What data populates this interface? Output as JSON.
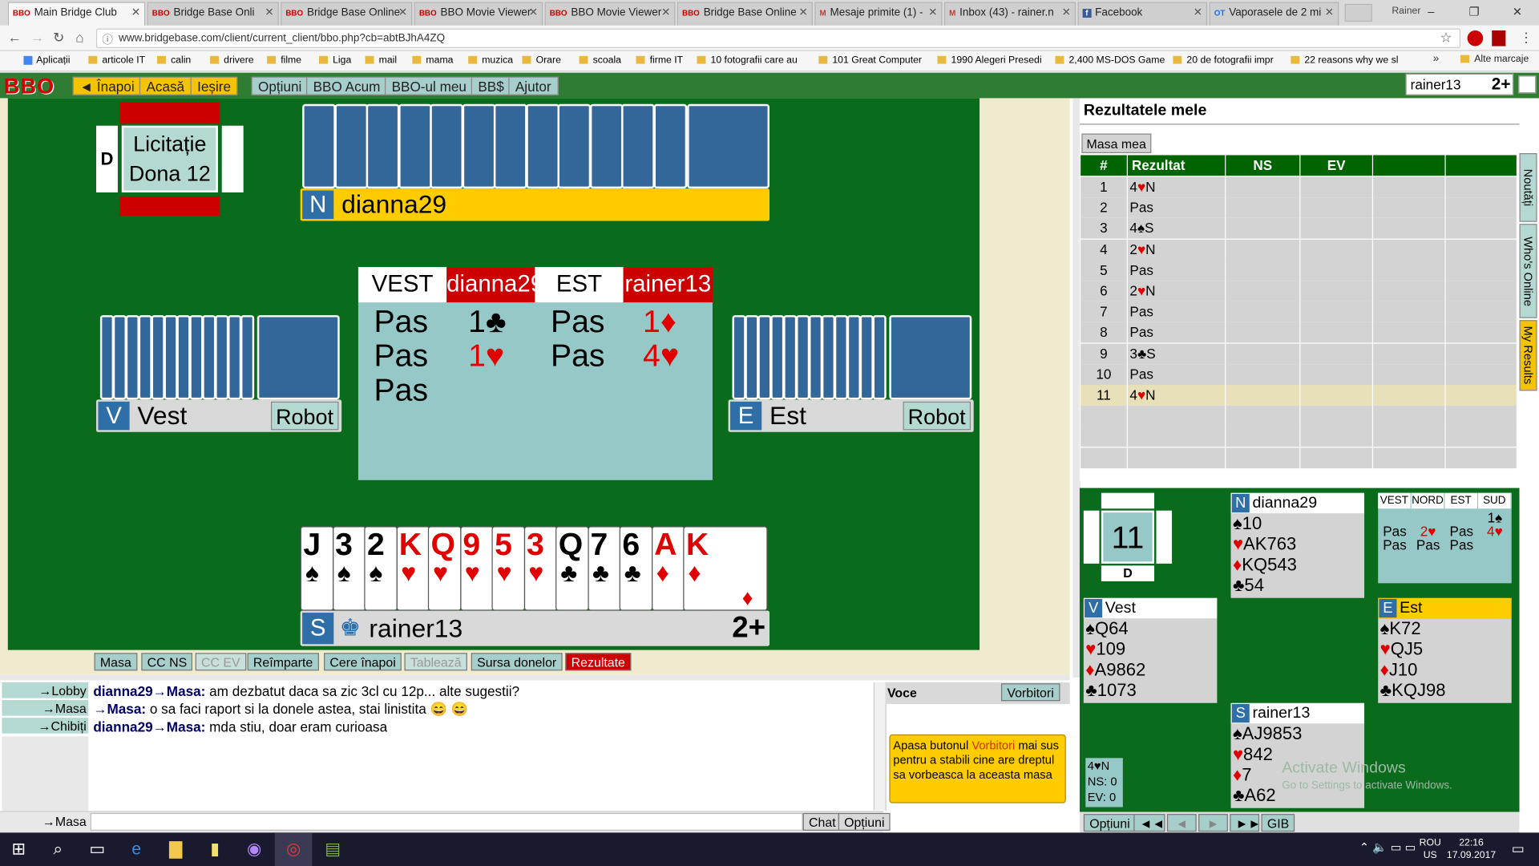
{
  "browser": {
    "tabs": [
      {
        "label": "Main Bridge Club",
        "icon": "BBO"
      },
      {
        "label": "Bridge Base Onli",
        "icon": "BBO"
      },
      {
        "label": "Bridge Base Online",
        "icon": "BBO"
      },
      {
        "label": "BBO Movie Viewer",
        "icon": "BBO"
      },
      {
        "label": "BBO Movie Viewer",
        "icon": "BBO"
      },
      {
        "label": "Bridge Base Online",
        "icon": "BBO"
      },
      {
        "label": "Mesaje primite (1) -",
        "icon": "M"
      },
      {
        "label": "Inbox (43) - rainer.n",
        "icon": "M"
      },
      {
        "label": "Facebook",
        "icon": "f"
      },
      {
        "label": "Vaporasele de 2 mi",
        "icon": "OT"
      }
    ],
    "user_name": "Rainer",
    "url": "www.bridgebase.com/client/current_client/bbo.php?cb=abtBJhA4ZQ",
    "bookmarks": [
      "Aplicații",
      "articole IT",
      "calin",
      "drivere",
      "filme",
      "Liga",
      "mail",
      "mama",
      "muzica",
      "Orare",
      "scoala",
      "firme IT",
      "10 fotografii care au",
      "101 Great Computer",
      "1990 Alegeri Presedi",
      "2,400 MS-DOS Game",
      "20 de fotografii impr",
      "22 reasons why we sl"
    ],
    "bookmarks_more": "»",
    "other_bookmarks": "Alte marcaje"
  },
  "bbo_toolbar": {
    "logo": "BBO",
    "back": "◄ Înapoi",
    "home": "Acasă",
    "exit": "Ieșire",
    "options": "Opțiuni",
    "bbo_now": "BBO Acum",
    "my_bbo": "BBO-ul meu",
    "bbs": "BB$",
    "help": "Ajutor",
    "username": "rainer13",
    "badge": "2+"
  },
  "table": {
    "dealer_label": "D",
    "phase_line1": "Licitație",
    "phase_line2": "Dona 12",
    "north": {
      "seat": "N",
      "name": "dianna29"
    },
    "west": {
      "seat": "V",
      "name": "Vest",
      "tag": "Robot"
    },
    "east": {
      "seat": "E",
      "name": "Est",
      "tag": "Robot"
    },
    "south": {
      "seat": "S",
      "name": "rainer13",
      "badge": "2+"
    },
    "bidding_headers": [
      "VEST",
      "dianna29",
      "EST",
      "rainer13"
    ],
    "bids": [
      {
        "text": "Pas",
        "color": "#000"
      },
      {
        "text": "1♣",
        "color": "#000"
      },
      {
        "text": "Pas",
        "color": "#000"
      },
      {
        "text": "1♦",
        "color": "#e00000"
      },
      {
        "text": "Pas",
        "color": "#000"
      },
      {
        "text": "1♥",
        "color": "#e00000"
      },
      {
        "text": "Pas",
        "color": "#000"
      },
      {
        "text": "4♥",
        "color": "#e00000"
      },
      {
        "text": "Pas",
        "color": "#000"
      }
    ],
    "south_hand": [
      {
        "rank": "J",
        "suit": "♠",
        "red": false
      },
      {
        "rank": "3",
        "suit": "♠",
        "red": false
      },
      {
        "rank": "2",
        "suit": "♠",
        "red": false
      },
      {
        "rank": "K",
        "suit": "♥",
        "red": true
      },
      {
        "rank": "Q",
        "suit": "♥",
        "red": true
      },
      {
        "rank": "9",
        "suit": "♥",
        "red": true
      },
      {
        "rank": "5",
        "suit": "♥",
        "red": true
      },
      {
        "rank": "3",
        "suit": "♥",
        "red": true
      },
      {
        "rank": "Q",
        "suit": "♣",
        "red": false
      },
      {
        "rank": "7",
        "suit": "♣",
        "red": false
      },
      {
        "rank": "6",
        "suit": "♣",
        "red": false
      },
      {
        "rank": "A",
        "suit": "♦",
        "red": true
      },
      {
        "rank": "K",
        "suit": "♦",
        "red": true
      }
    ],
    "bottom_buttons": [
      "Masa",
      "CC NS",
      "CC EV",
      "Reîmparte",
      "Cere înapoi",
      "Tablează",
      "Sursa donelor",
      "Rezultate"
    ]
  },
  "results": {
    "title": "Rezultatele mele",
    "tab": "Masa mea",
    "columns": [
      "#",
      "Rezultat",
      "NS",
      "EV"
    ],
    "rows": [
      {
        "n": "1",
        "r": "4♥N",
        "red": true
      },
      {
        "n": "2",
        "r": "Pas",
        "red": false
      },
      {
        "n": "3",
        "r": "4♠S",
        "red": false
      },
      {
        "n": "4",
        "r": "2♥N",
        "red": true
      },
      {
        "n": "5",
        "r": "Pas",
        "red": false
      },
      {
        "n": "6",
        "r": "2♥N",
        "red": true
      },
      {
        "n": "7",
        "r": "Pas",
        "red": false
      },
      {
        "n": "8",
        "r": "Pas",
        "red": false
      },
      {
        "n": "9",
        "r": "3♣S",
        "red": false
      },
      {
        "n": "10",
        "r": "Pas",
        "red": false
      },
      {
        "n": "11",
        "r": "4♥N",
        "red": true
      }
    ],
    "side_tabs": [
      "Noutăți",
      "Who's Online",
      "My Results"
    ]
  },
  "mini": {
    "board": "11",
    "dealer": "D",
    "north": {
      "seat": "N",
      "name": "dianna29",
      "s": "10",
      "h": "AK763",
      "d": "KQ543",
      "c": "54"
    },
    "west": {
      "seat": "V",
      "name": "Vest",
      "s": "Q64",
      "h": "109",
      "d": "A9862",
      "c": "1073"
    },
    "east": {
      "seat": "E",
      "name": "Est",
      "s": "K72",
      "h": "QJ5",
      "d": "J10",
      "c": "KQJ98"
    },
    "south": {
      "seat": "S",
      "name": "rainer13",
      "s": "AJ9853",
      "h": "842",
      "d": "7",
      "c": "A62"
    },
    "auction_headers": [
      "VEST",
      "NORD",
      "EST",
      "SUD"
    ],
    "auction_row1": [
      "",
      "",
      "",
      "1♠"
    ],
    "auction_row2": [
      "Pas",
      "2♥",
      "Pas",
      "4♥"
    ],
    "auction_row3": [
      "Pas",
      "Pas",
      "Pas",
      ""
    ],
    "contract": "4♥N",
    "ns_score": "NS: 0",
    "ev_score": "EV: 0",
    "nav": {
      "options": "Opțiuni",
      "first": "◄◄",
      "prev": "◄",
      "next": "►",
      "last": "►►",
      "gib": "GIB"
    },
    "watermark1": "Activate Windows",
    "watermark2": "Go to Settings to activate Windows."
  },
  "chat": {
    "targets": [
      "→Lobby",
      "→Masa",
      "→Chibiți"
    ],
    "messages": [
      {
        "from": "dianna29→Masa:",
        "text": " am dezbatut daca sa zic 3cl cu 12p... alte sugestii?"
      },
      {
        "from": "→Masa:",
        "text": " o sa faci raport si la donele astea, stai linistita 😄 😄"
      },
      {
        "from": "dianna29→Masa:",
        "text": " mda stiu, doar eram curioasa"
      }
    ],
    "input_target": "→Masa",
    "chat_btn": "Chat",
    "options_btn": "Opțiuni",
    "voice_title": "Voce",
    "speakers_btn": "Vorbitori",
    "voice_note_pre": "Apasa butonul ",
    "voice_note_link": "Vorbitori",
    "voice_note_post": " mai sus pentru a stabili cine are dreptul sa vorbeasca la aceasta masa"
  },
  "taskbar": {
    "lang1": "ROU",
    "lang2": "US",
    "time": "22:16",
    "date": "17.09.2017"
  }
}
